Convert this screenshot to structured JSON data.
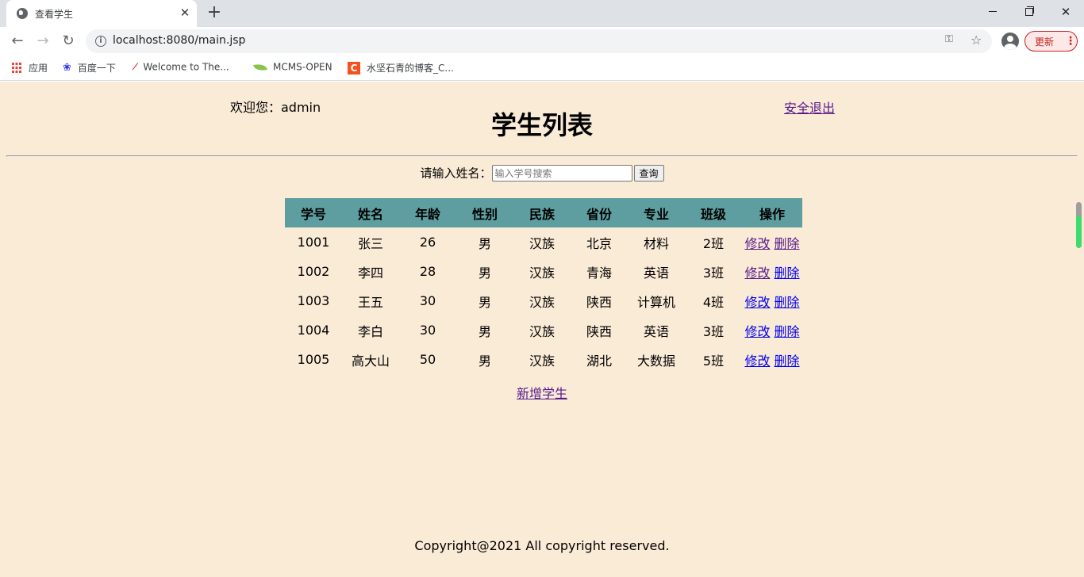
{
  "browser": {
    "tab": {
      "title": "查看学生",
      "favicon": "globe-icon",
      "close_icon": "close-icon"
    },
    "new_tab_icon": "plus-icon",
    "window_controls": {
      "minimize": "minimize-icon",
      "restore": "restore-icon",
      "close": "close-icon"
    },
    "nav": {
      "back": "←",
      "forward": "→",
      "reload": "↻"
    },
    "url": "localhost:8080/main.jsp",
    "update_button": "更新",
    "bookmarks": [
      {
        "label": "应用",
        "icon": "apps-grid-icon"
      },
      {
        "label": "百度一下",
        "icon": "baidu-paw-icon"
      },
      {
        "label": "Welcome to The...",
        "icon": "feather-icon"
      },
      {
        "label": "MCMS-OPEN",
        "icon": "leaf-icon"
      },
      {
        "label": "水坚石青的博客_C...",
        "icon": "csdn-icon"
      }
    ]
  },
  "page": {
    "welcome_text": "欢迎您：admin",
    "logout_link": "安全退出",
    "title": "学生列表",
    "search": {
      "label": "请输入姓名：",
      "placeholder": "输入学号搜索",
      "value": "",
      "button": "查询"
    },
    "table": {
      "headers": [
        "学号",
        "姓名",
        "年龄",
        "性别",
        "民族",
        "省份",
        "专业",
        "班级",
        "操作"
      ],
      "rows": [
        {
          "id": "1001",
          "name": "张三",
          "age": "26",
          "gender": "男",
          "ethnicity": "汉族",
          "province": "北京",
          "major": "材料",
          "class": "2班",
          "edit": "修改",
          "delete": "删除",
          "edit_visited": true,
          "delete_visited": true
        },
        {
          "id": "1002",
          "name": "李四",
          "age": "28",
          "gender": "男",
          "ethnicity": "汉族",
          "province": "青海",
          "major": "英语",
          "class": "3班",
          "edit": "修改",
          "delete": "删除",
          "edit_visited": true,
          "delete_visited": false
        },
        {
          "id": "1003",
          "name": "王五",
          "age": "30",
          "gender": "男",
          "ethnicity": "汉族",
          "province": "陕西",
          "major": "计算机",
          "class": "4班",
          "edit": "修改",
          "delete": "删除",
          "edit_visited": false,
          "delete_visited": false
        },
        {
          "id": "1004",
          "name": "李白",
          "age": "30",
          "gender": "男",
          "ethnicity": "汉族",
          "province": "陕西",
          "major": "英语",
          "class": "3班",
          "edit": "修改",
          "delete": "删除",
          "edit_visited": false,
          "delete_visited": false
        },
        {
          "id": "1005",
          "name": "高大山",
          "age": "50",
          "gender": "男",
          "ethnicity": "汉族",
          "province": "湖北",
          "major": "大数据",
          "class": "5班",
          "edit": "修改",
          "delete": "删除",
          "edit_visited": false,
          "delete_visited": false
        }
      ]
    },
    "add_student_link": "新增学生",
    "footer": "Copyright@2021 All copyright reserved."
  },
  "colors": {
    "page_background": "#faebd7",
    "table_header_background": "#5f9ea0",
    "link_visited": "#551a8b",
    "link_unvisited": "#0000ee"
  }
}
